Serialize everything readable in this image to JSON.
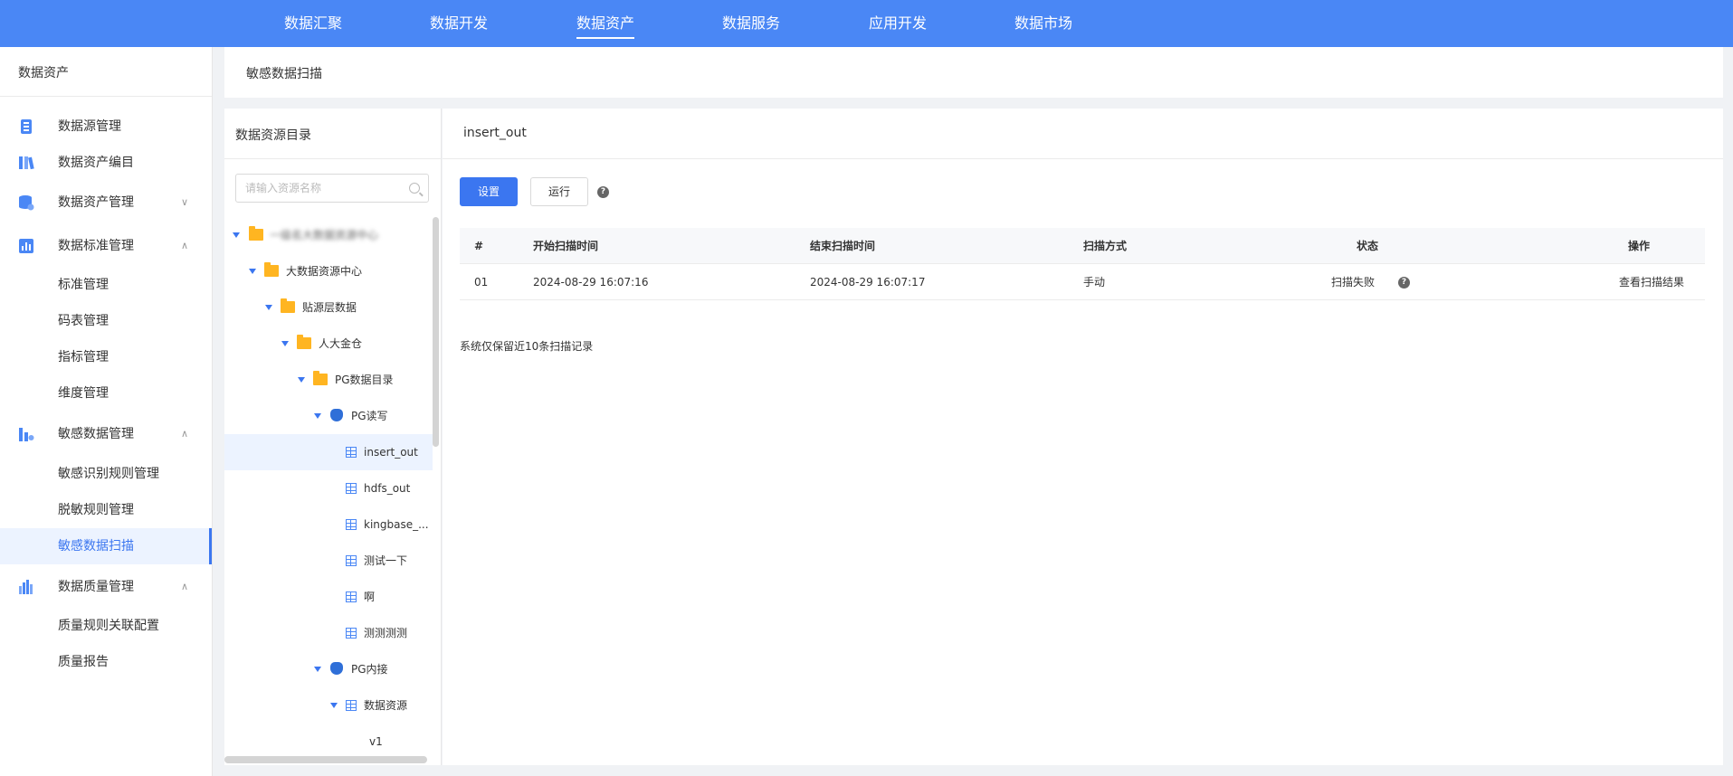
{
  "topnav": {
    "items": [
      {
        "label": "数据汇聚"
      },
      {
        "label": "数据开发"
      },
      {
        "label": "数据资产"
      },
      {
        "label": "数据服务"
      },
      {
        "label": "应用开发"
      },
      {
        "label": "数据市场"
      }
    ],
    "active": "数据资产"
  },
  "sidebar": {
    "title": "数据资产",
    "items": [
      {
        "label": "数据源管理",
        "icon": "datasource-icon"
      },
      {
        "label": "数据资产编目",
        "icon": "catalog-icon"
      },
      {
        "label": "数据资产管理",
        "icon": "database-icon"
      },
      {
        "label": "数据标准管理",
        "icon": "standard-icon"
      },
      {
        "label": "标准管理"
      },
      {
        "label": "码表管理"
      },
      {
        "label": "指标管理"
      },
      {
        "label": "维度管理"
      },
      {
        "label": "敏感数据管理",
        "icon": "sensitive-icon"
      },
      {
        "label": "敏感识别规则管理"
      },
      {
        "label": "脱敏规则管理"
      },
      {
        "label": "敏感数据扫描"
      },
      {
        "label": "数据质量管理",
        "icon": "quality-icon"
      },
      {
        "label": "质量规则关联配置"
      },
      {
        "label": "质量报告"
      }
    ],
    "accent": "#3b76f0"
  },
  "page": {
    "title": "敏感数据扫描"
  },
  "tree": {
    "title": "数据资源目录",
    "search_placeholder": "请输入资源名称",
    "nodes": [
      {
        "label": "一级名大数据资源中心"
      },
      {
        "label": "大数据资源中心"
      },
      {
        "label": "贴源层数据"
      },
      {
        "label": "人大金仓"
      },
      {
        "label": "PG数据目录"
      },
      {
        "label": "PG读写"
      },
      {
        "label": "insert_out"
      },
      {
        "label": "hdfs_out"
      },
      {
        "label": "kingbase_..."
      },
      {
        "label": "测试一下"
      },
      {
        "label": "啊"
      },
      {
        "label": "测测测测"
      },
      {
        "label": "PG内接"
      },
      {
        "label": "数据资源"
      },
      {
        "label": "v1"
      }
    ]
  },
  "main": {
    "title": "insert_out",
    "settings_label": "设置",
    "run_label": "运行",
    "table": {
      "headers": [
        "#",
        "开始扫描时间",
        "结束扫描时间",
        "扫描方式",
        "状态",
        "操作"
      ],
      "rows": [
        {
          "index": "01",
          "start": "2024-08-29 16:07:16",
          "end": "2024-08-29 16:07:17",
          "mode": "手动",
          "status": "扫描失败",
          "action": "查看扫描结果"
        }
      ]
    },
    "footnote": "系统仅保留近10条扫描记录"
  },
  "colors": {
    "topnav_bg": "#4a87f5",
    "primary": "#3b76f0",
    "folder": "#ffb521"
  }
}
